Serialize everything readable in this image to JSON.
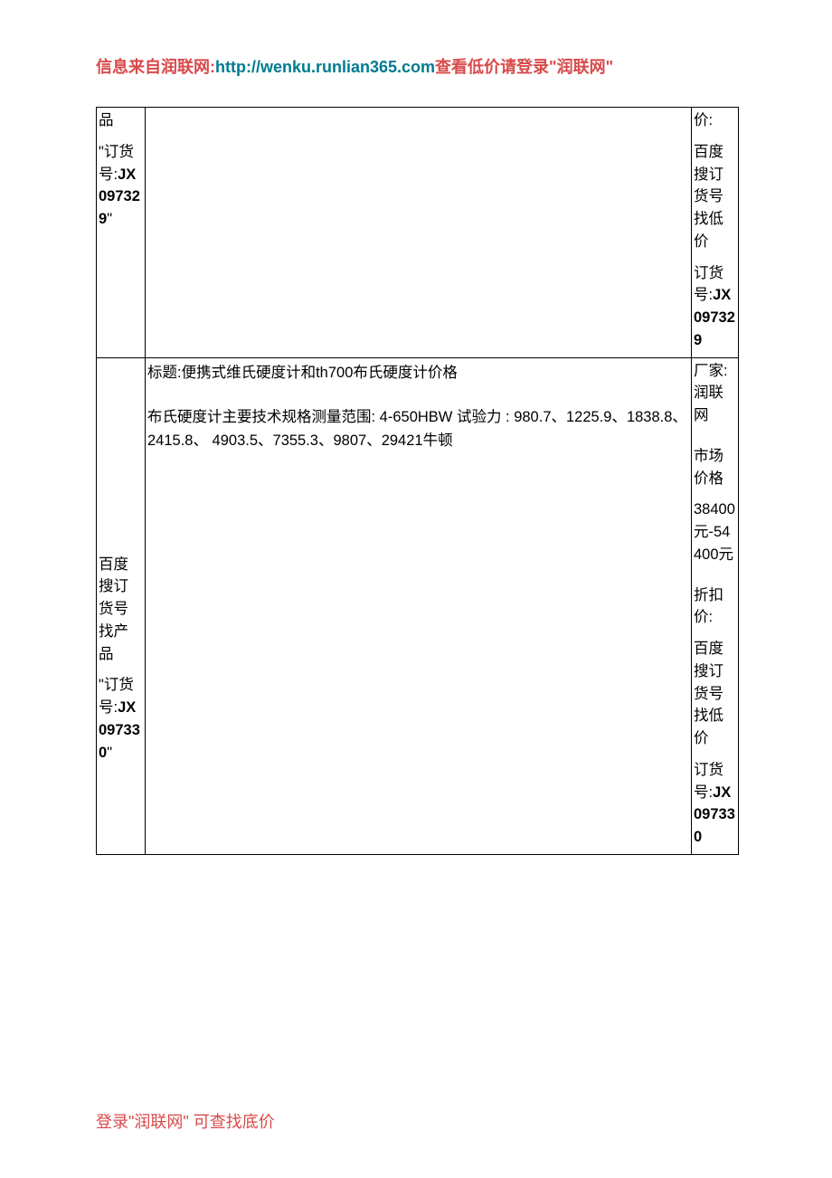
{
  "header": {
    "prefix": "信息来自润联网:",
    "url": "http://wenku.runlian365.com",
    "suffix": "查看低价请登录\"润联网\""
  },
  "rows": [
    {
      "left": {
        "tail_text": "品",
        "order_label": "\"订货号:",
        "order_number": "JX097329",
        "order_close": "\""
      },
      "center": {
        "title": "",
        "body": ""
      },
      "right": {
        "tail_text": "价:",
        "search_hint": "百度搜订货号找低价",
        "order_label": "订货号:",
        "order_number": "JX097329"
      }
    },
    {
      "left": {
        "search_hint": "百度搜订货号找产品",
        "order_label": "\"订货号:",
        "order_number": "JX097330",
        "order_close": "\""
      },
      "center": {
        "title": "标题:便携式维氏硬度计和th700布氏硬度计价格",
        "body": "布氏硬度计主要技术规格测量范围: 4-650HBW 试验力 : 980.7、1225.9、1838.8、2415.8、 4903.5、7355.3、9807、29421牛顿"
      },
      "right": {
        "maker_label": "厂家:",
        "maker_value": "润联网",
        "market_label": "市场价格",
        "market_value": "38400元-54400元",
        "discount_label": "折扣价:",
        "search_hint": "百度搜订货号找低价",
        "order_label": "订货号:",
        "order_number": "JX097330"
      }
    }
  ],
  "footer": "登录\"润联网\" 可查找底价"
}
